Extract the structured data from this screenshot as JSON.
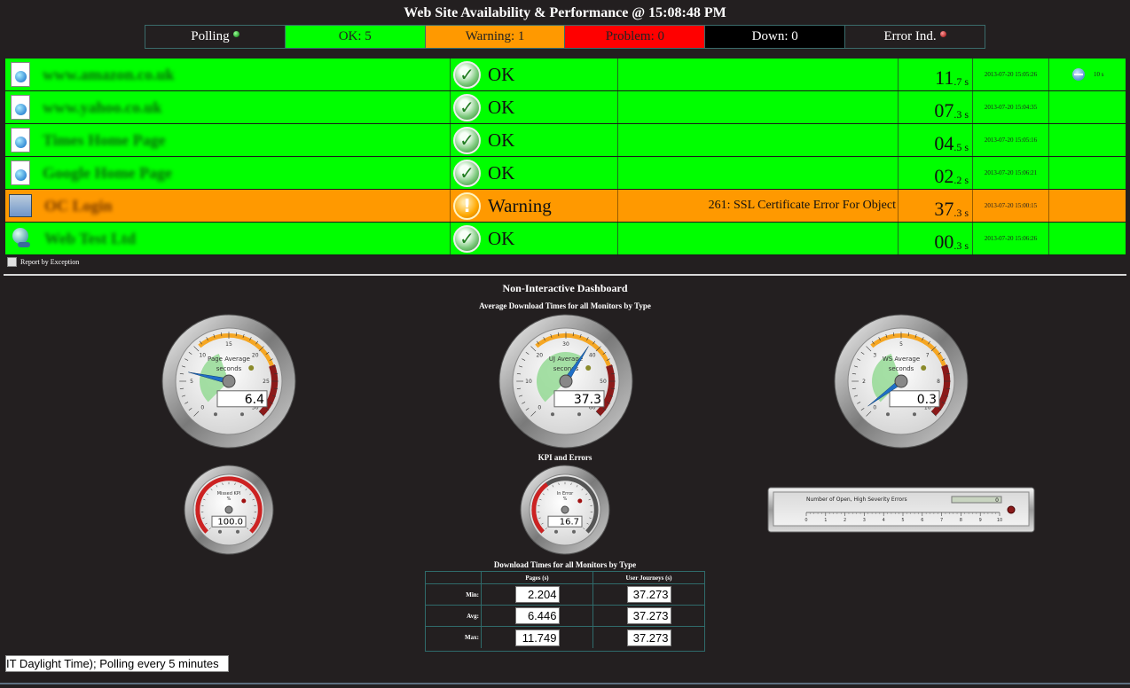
{
  "header": {
    "title": "Web Site Availability & Performance @ 15:08:48 PM",
    "polling": "Polling",
    "ok": "OK: 5",
    "warning": "Warning: 1",
    "problem": "Problem: 0",
    "down": "Down: 0",
    "error_ind": "Error Ind."
  },
  "monitors": [
    {
      "name": "www.amazon.co.uk",
      "icon": "page-globe-icon",
      "status": "OK",
      "desc": "",
      "time_big": "11",
      "time_small": ".7 s",
      "stamp": "2013-07-20 15:05:26",
      "extra": "10 s",
      "level": "ok"
    },
    {
      "name": "www.yahoo.co.uk",
      "icon": "page-globe-icon",
      "status": "OK",
      "desc": "",
      "time_big": "07",
      "time_small": ".3 s",
      "stamp": "2013-07-20 15:04:35",
      "extra": "",
      "level": "ok"
    },
    {
      "name": "Times Home Page",
      "icon": "page-globe-icon",
      "status": "OK",
      "desc": "",
      "time_big": "04",
      "time_small": ".5 s",
      "stamp": "2013-07-20 15:05:16",
      "extra": "",
      "level": "ok"
    },
    {
      "name": "Google Home Page",
      "icon": "page-globe-icon",
      "status": "OK",
      "desc": "",
      "time_big": "02",
      "time_small": ".2 s",
      "stamp": "2013-07-20 15:06:21",
      "extra": "",
      "level": "ok"
    },
    {
      "name": "OC Login",
      "icon": "application-icon",
      "status": "Warning",
      "desc": "261: SSL Certificate Error For Object",
      "time_big": "37",
      "time_small": ".3 s",
      "stamp": "2013-07-20 15:00:15",
      "extra": "",
      "level": "warn"
    },
    {
      "name": "Web Test Ltd",
      "icon": "web-service-icon",
      "status": "OK",
      "desc": "",
      "time_big": "00",
      "time_small": ".3 s",
      "stamp": "2013-07-20 15:06:26",
      "extra": "",
      "level": "ok"
    }
  ],
  "report_by_exception": "Report by Exception",
  "dashboard": {
    "title": "Non-Interactive Dashboard",
    "avg_title": "Average Download Times for all Monitors by Type",
    "kpi_title": "KPI and Errors",
    "table_title": "Download Times for all Monitors by Type"
  },
  "gauges": {
    "page": {
      "label1": "Page Average",
      "label2": "seconds",
      "value": "6.4",
      "num": 6.4,
      "min": 0,
      "max": 30
    },
    "uj": {
      "label1": "UJ Average",
      "label2": "seconds",
      "value": "37.3",
      "num": 37.3,
      "min": 0,
      "max": 60
    },
    "ws": {
      "label1": "WS Average",
      "label2": "seconds",
      "value": "0.3",
      "num": 0.3,
      "min": 0,
      "max": 10
    },
    "kpi": {
      "label1": "Missed KPI",
      "label2": "%",
      "value": "100.0",
      "num": 100
    },
    "err": {
      "label1": "In Error",
      "label2": "%",
      "value": "16.7",
      "num": 16.7
    }
  },
  "linear_gauge": {
    "label": "Number of Open, High Severity Errors",
    "value": "0",
    "ticks": [
      "0",
      "1",
      "2",
      "3",
      "4",
      "5",
      "6",
      "7",
      "8",
      "9",
      "10"
    ]
  },
  "table": {
    "col_pages": "Pages (s)",
    "col_uj": "User Journeys (s)",
    "rows": [
      {
        "label": "Min:",
        "pages": "2.204",
        "uj": "37.273"
      },
      {
        "label": "Avg:",
        "pages": "6.446",
        "uj": "37.273"
      },
      {
        "label": "Max:",
        "pages": "11.749",
        "uj": "37.273"
      }
    ]
  },
  "timezone_text": "IT Daylight Time); Polling every 5 minutes",
  "colors": {
    "ok": "#00ff00",
    "warning": "#ff9900",
    "problem": "#ff0000",
    "down": "#000000",
    "background": "#231f20"
  }
}
